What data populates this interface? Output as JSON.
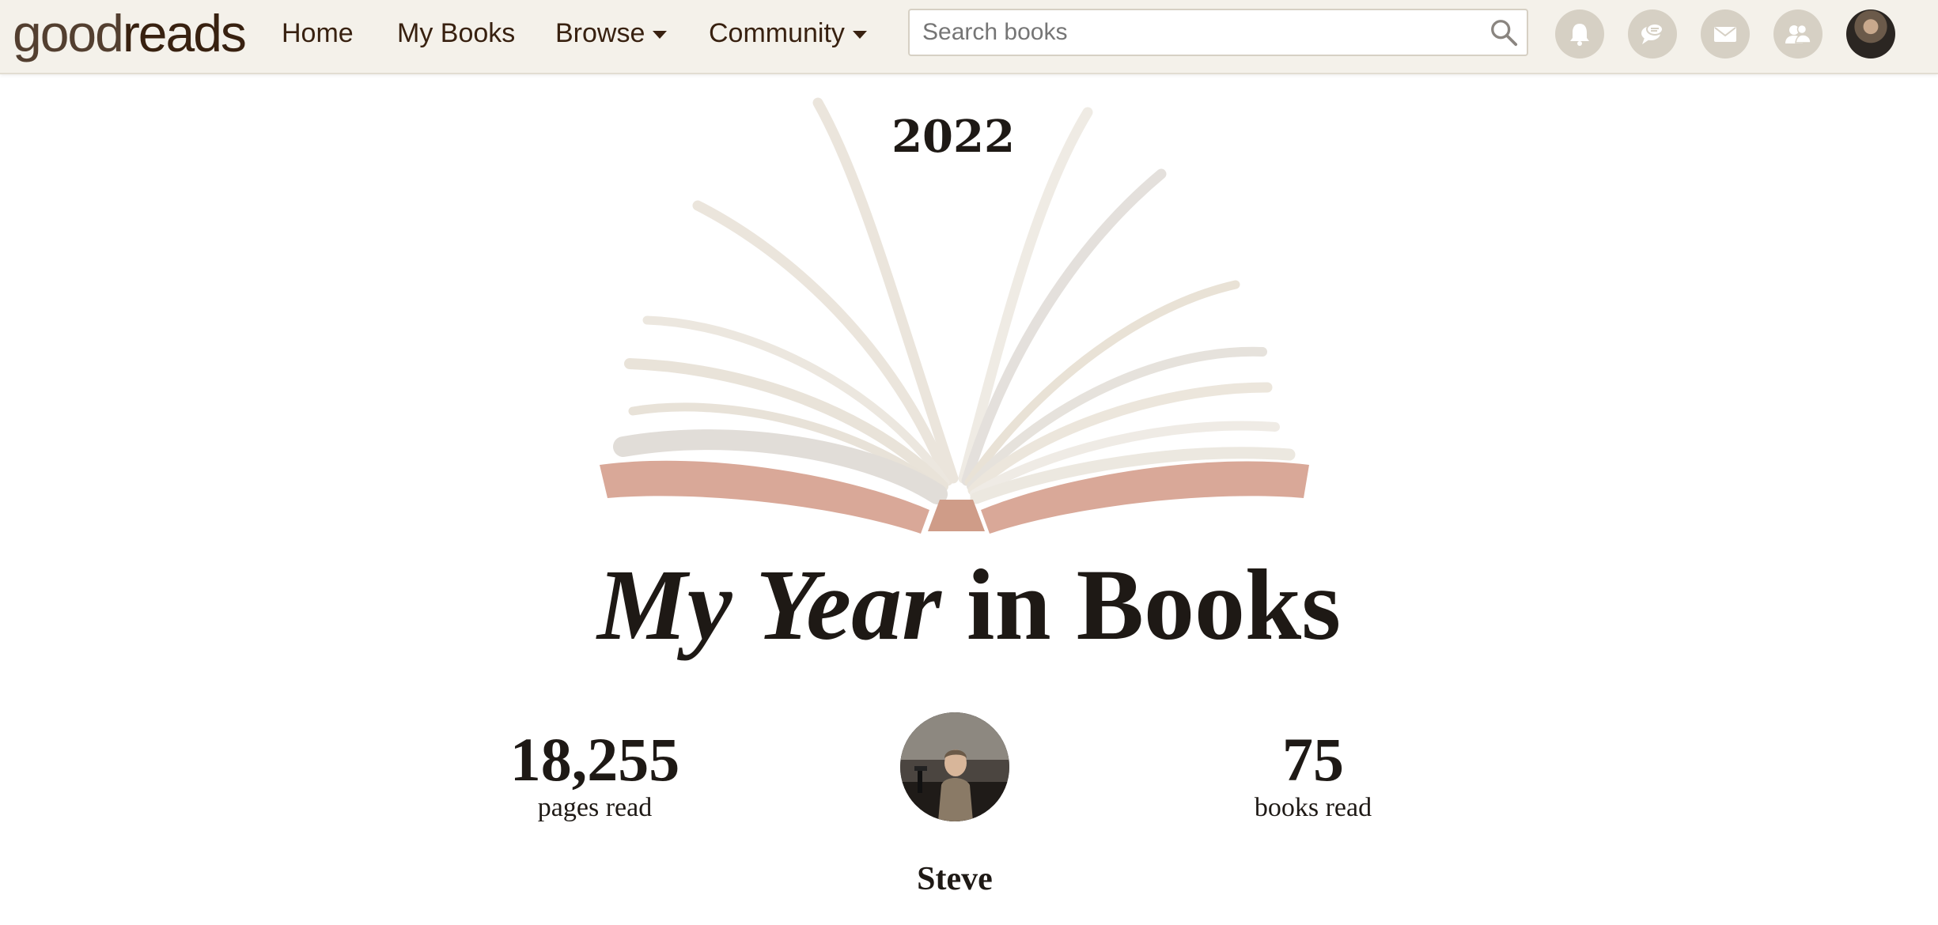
{
  "nav": {
    "logo_light": "good",
    "logo_bold": "reads",
    "items": [
      {
        "label": "Home"
      },
      {
        "label": "My Books"
      },
      {
        "label": "Browse"
      },
      {
        "label": "Community"
      }
    ],
    "search_placeholder": "Search books",
    "icons": [
      "bell-icon",
      "chat-icon",
      "mail-icon",
      "friends-icon"
    ]
  },
  "hero": {
    "year": "2022",
    "headline_italic": "My Year",
    "headline_plain": "in Books"
  },
  "stats": {
    "pages_value": "18,255",
    "pages_label": "pages read",
    "books_value": "75",
    "books_label": "books read"
  },
  "user": {
    "name": "Steve"
  },
  "colors": {
    "nav_bg": "#f4f1ea",
    "brand_text": "#382110",
    "icon_circle": "#d6d0c4",
    "cover_rose": "#d9a898",
    "page_cream": "#ebe5dc"
  }
}
